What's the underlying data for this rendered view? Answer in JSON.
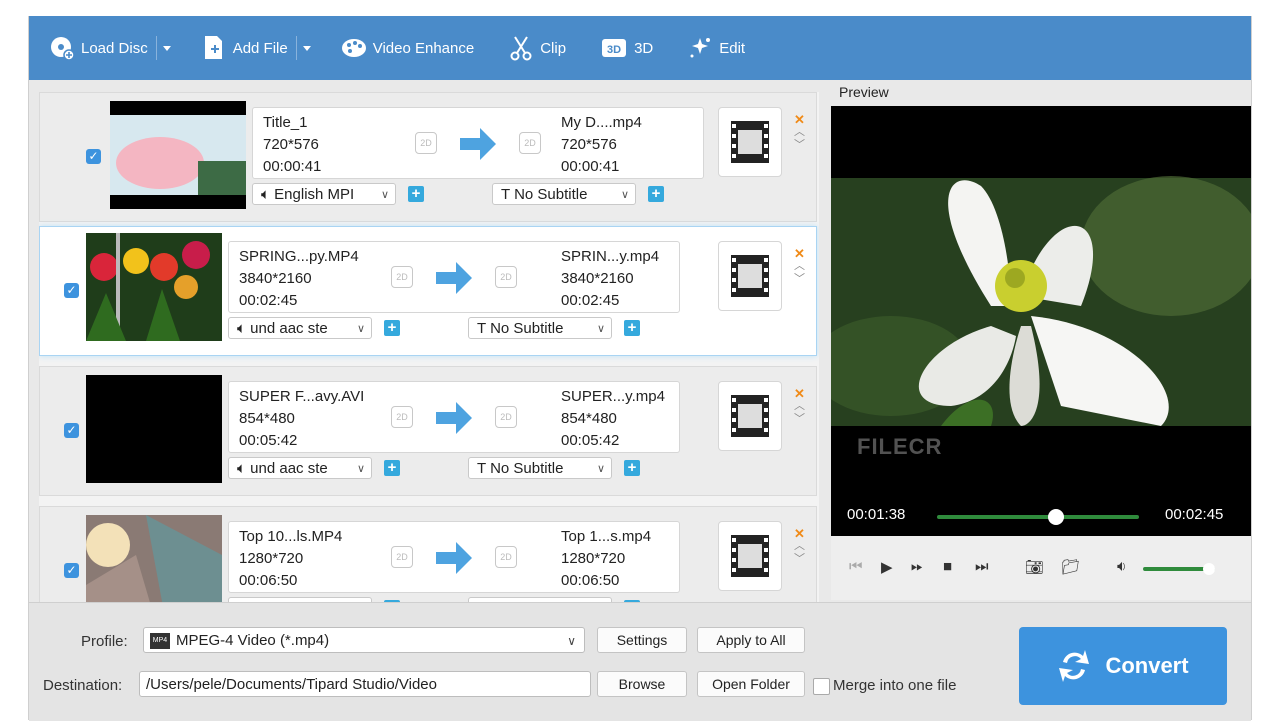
{
  "toolbar": {
    "load_disc": "Load Disc",
    "add_file": "Add File",
    "video_enhance": "Video Enhance",
    "clip": "Clip",
    "three_d": "3D",
    "edit": "Edit"
  },
  "rows": [
    {
      "src_name": "Title_1",
      "src_res": "720*576",
      "src_dur": "00:00:41",
      "dst_name": "My D....mp4",
      "dst_res": "720*576",
      "dst_dur": "00:00:41",
      "audio": "English MPI",
      "subtitle": "No Subtitle"
    },
    {
      "src_name": "SPRING...py.MP4",
      "src_res": "3840*2160",
      "src_dur": "00:02:45",
      "dst_name": "SPRIN...y.mp4",
      "dst_res": "3840*2160",
      "dst_dur": "00:02:45",
      "audio": "und aac ste",
      "subtitle": "No Subtitle"
    },
    {
      "src_name": "SUPER F...avy.AVI",
      "src_res": "854*480",
      "src_dur": "00:05:42",
      "dst_name": "SUPER...y.mp4",
      "dst_res": "854*480",
      "dst_dur": "00:05:42",
      "audio": "und aac ste",
      "subtitle": "No Subtitle"
    },
    {
      "src_name": "Top 10...ls.MP4",
      "src_res": "1280*720",
      "src_dur": "00:06:50",
      "dst_name": "Top 1...s.mp4",
      "dst_res": "1280*720",
      "dst_dur": "00:06:50",
      "audio": "",
      "subtitle": ""
    }
  ],
  "badge_2d": "2D",
  "preview": {
    "label": "Preview",
    "current_time": "00:01:38",
    "total_time": "00:02:45",
    "progress": 0.59,
    "volume": 0.92,
    "watermark": "FILECR"
  },
  "bottom": {
    "profile_label": "Profile:",
    "profile_value": "MPEG-4 Video (*.mp4)",
    "settings": "Settings",
    "apply_to_all": "Apply to All",
    "destination_label": "Destination:",
    "destination_value": "/Users/pele/Documents/Tipard Studio/Video",
    "browse": "Browse",
    "open_folder": "Open Folder",
    "merge": "Merge into one file",
    "convert": "Convert"
  }
}
